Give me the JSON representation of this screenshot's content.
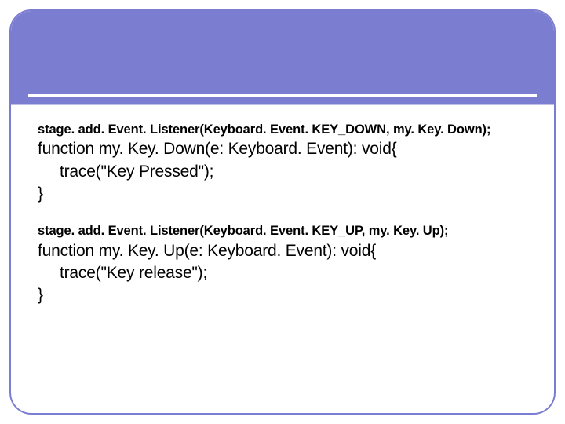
{
  "code": {
    "block1": {
      "listener": "stage. add. Event. Listener(Keyboard. Event. KEY_DOWN, my. Key. Down);",
      "fn_open": "function my. Key. Down(e: Keyboard. Event): void{",
      "trace": "trace(\"Key Pressed\");",
      "fn_close": "}"
    },
    "block2": {
      "listener": "stage. add. Event. Listener(Keyboard. Event. KEY_UP, my. Key. Up);",
      "fn_open": "function my. Key. Up(e: Keyboard. Event): void{",
      "trace": "trace(\"Key release\");",
      "fn_close": "}"
    }
  }
}
